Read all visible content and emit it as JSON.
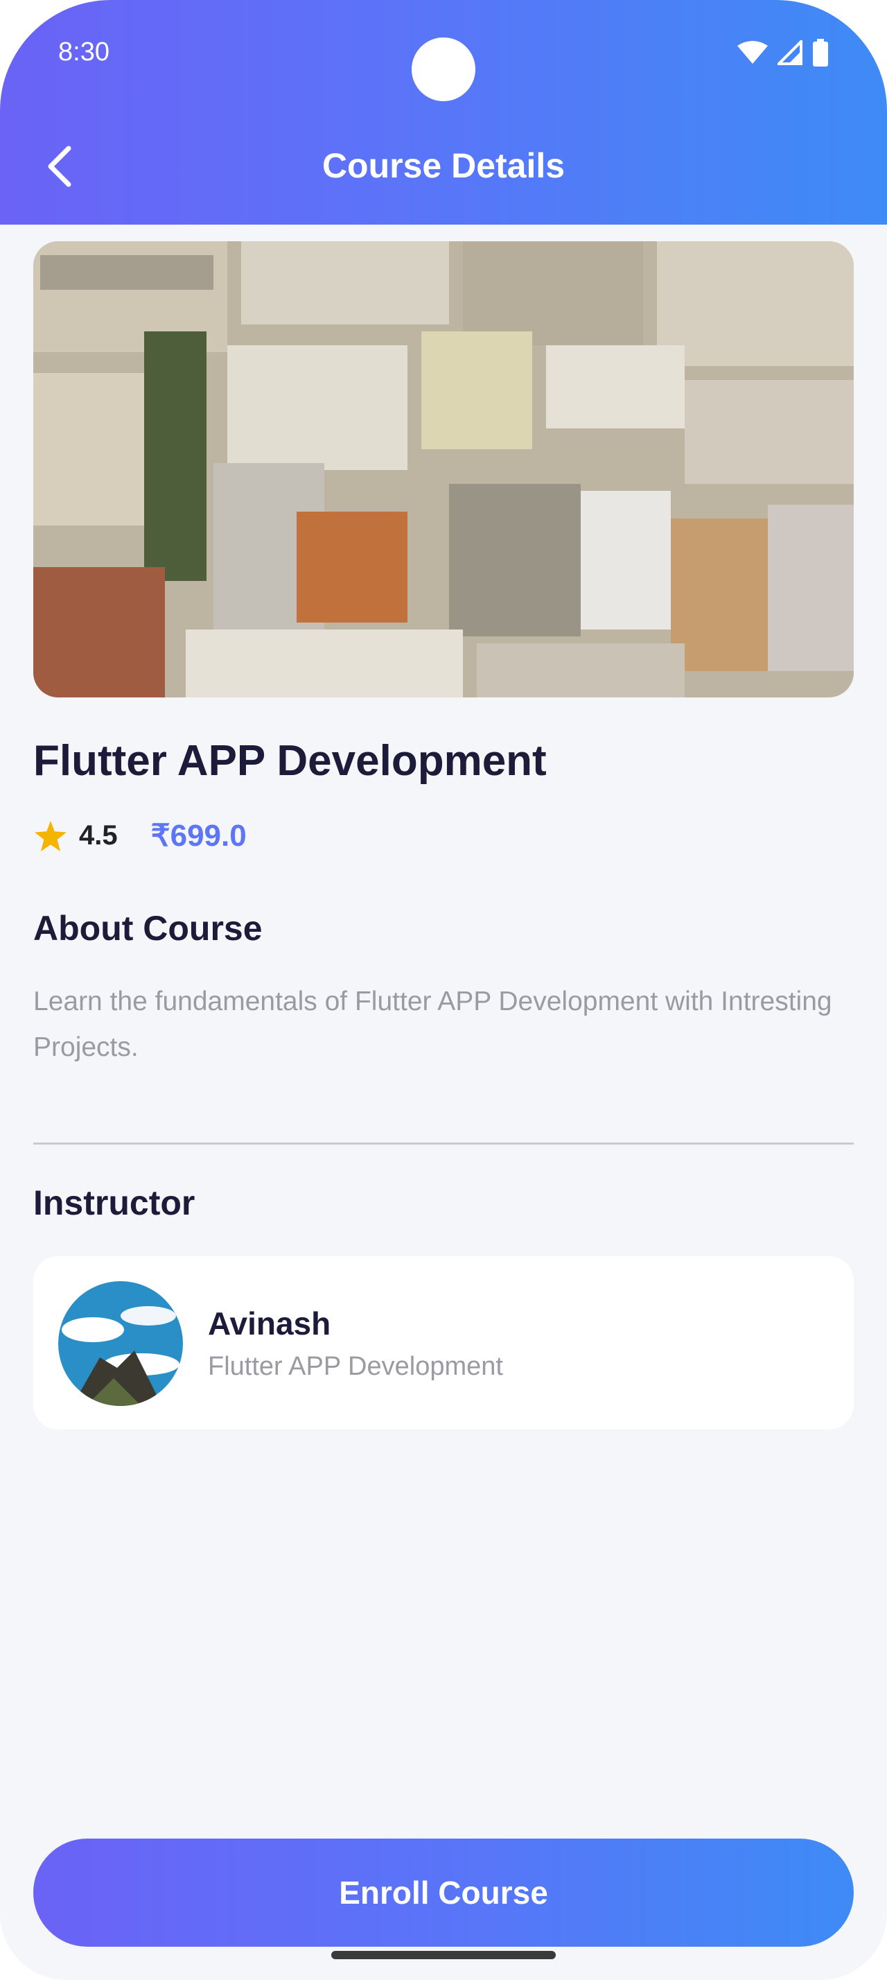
{
  "status_bar": {
    "time": "8:30",
    "icons": [
      "wifi-icon",
      "cellular-icon",
      "battery-icon"
    ]
  },
  "header": {
    "title": "Course Details",
    "back_icon": "chevron-left-icon"
  },
  "course": {
    "image": "city-rooftops-photo",
    "title": "Flutter APP Development",
    "rating": "4.5",
    "price": "₹699.0"
  },
  "about": {
    "heading": "About Course",
    "text": "Learn the fundamentals of Flutter APP Development with Intresting Projects."
  },
  "instructor": {
    "heading": "Instructor",
    "name": "Avinash",
    "subtitle": "Flutter APP Development",
    "avatar": "sky-clouds-mountain-photo"
  },
  "actions": {
    "enroll_label": "Enroll Course"
  },
  "colors": {
    "gradient_start": "#6a63f6",
    "gradient_end": "#3e8bf6",
    "price": "#5d76f6",
    "star": "#f5b400",
    "title_text": "#1c1b3a"
  }
}
